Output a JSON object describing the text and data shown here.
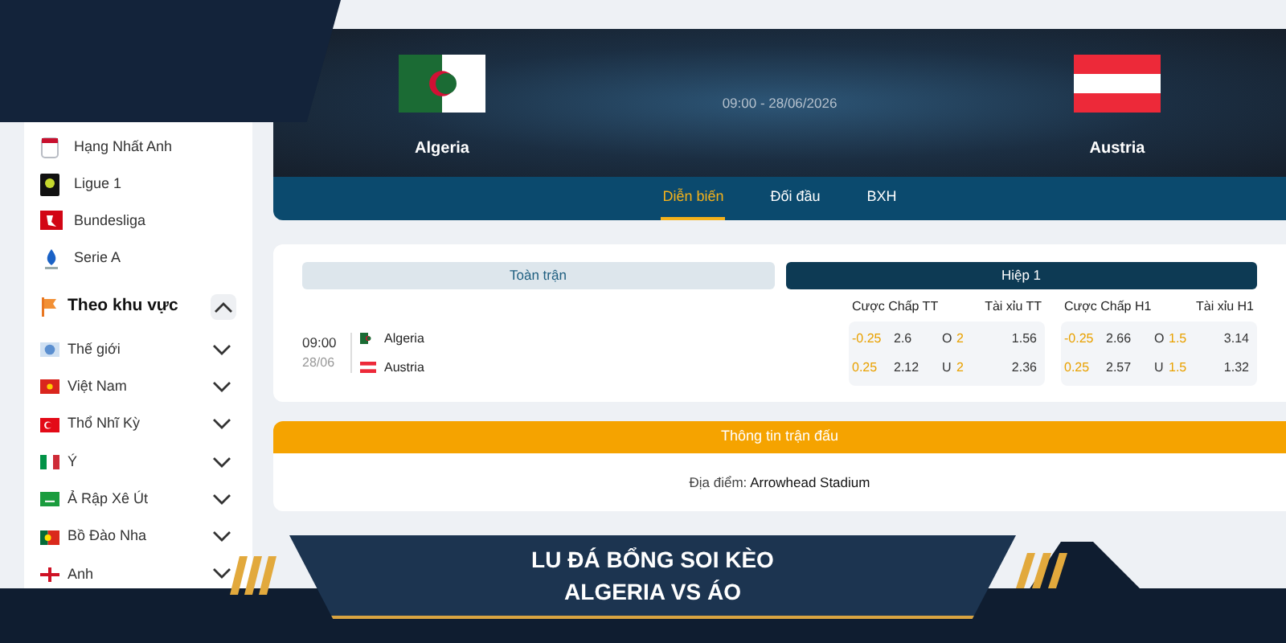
{
  "sidebar": {
    "leagues": [
      {
        "name": "Hạng Nhất Anh",
        "kind": "shield"
      },
      {
        "name": "Ligue 1",
        "kind": "ligue"
      },
      {
        "name": "Bundesliga",
        "kind": "bundes"
      },
      {
        "name": "Serie A",
        "kind": "seriea"
      }
    ],
    "region": {
      "title": "Theo khu vực",
      "expanded": true
    },
    "countries": [
      {
        "name": "Thế giới",
        "kind": "world",
        "expanded": false
      },
      {
        "name": "Việt Nam",
        "kind": "vietnam",
        "expanded": false
      },
      {
        "name": "Thổ Nhĩ Kỳ",
        "kind": "turkey",
        "expanded": false
      },
      {
        "name": "Ý",
        "kind": "italy",
        "expanded": false
      },
      {
        "name": "Ả Rập Xê Út",
        "kind": "saudi",
        "expanded": false
      },
      {
        "name": "Bồ Đào Nha",
        "kind": "portugal",
        "expanded": false
      },
      {
        "name": "Anh",
        "kind": "england",
        "expanded": false
      }
    ]
  },
  "match_header": {
    "home": {
      "name": "Algeria",
      "kind": "algeria"
    },
    "away": {
      "name": "Austria",
      "kind": "austria"
    },
    "kickoff": "09:00 - 28/06/2026",
    "tabs": [
      {
        "label": "Diễn biến",
        "selected": true
      },
      {
        "label": "Đối đầu",
        "selected": false
      },
      {
        "label": "BXH",
        "selected": false
      }
    ]
  },
  "odds": {
    "periods": [
      {
        "label": "Toàn trận",
        "selected": false
      },
      {
        "label": "Hiệp 1",
        "selected": true
      }
    ],
    "time": "09:00",
    "date": "28/06",
    "teams": [
      {
        "name": "Algeria",
        "kind": "algeria"
      },
      {
        "name": "Austria",
        "kind": "austria"
      }
    ],
    "markets": [
      {
        "headers": [
          "Cược Chấp TT",
          "Tài xỉu TT"
        ],
        "rows": [
          {
            "line": "-0.25",
            "odds": "2.6",
            "side": "O",
            "total": "2",
            "total_odds": "1.56"
          },
          {
            "line": "0.25",
            "odds": "2.12",
            "side": "U",
            "total": "2",
            "total_odds": "2.36"
          }
        ]
      },
      {
        "headers": [
          "Cược Chấp H1",
          "Tài xỉu H1"
        ],
        "rows": [
          {
            "line": "-0.25",
            "odds": "2.66",
            "side": "O",
            "total": "1.5",
            "total_odds": "3.14"
          },
          {
            "line": "0.25",
            "odds": "2.57",
            "side": "U",
            "total": "1.5",
            "total_odds": "1.32"
          }
        ]
      }
    ]
  },
  "match_info": {
    "title": "Thông tin trận đấu",
    "venue": "Địa điểm: **Arrowhead Stadium**"
  },
  "banner": {
    "lines": [
      "LU ĐÁ BỔNG SOI KÈO",
      "ALGERIA VS ÁO"
    ]
  }
}
